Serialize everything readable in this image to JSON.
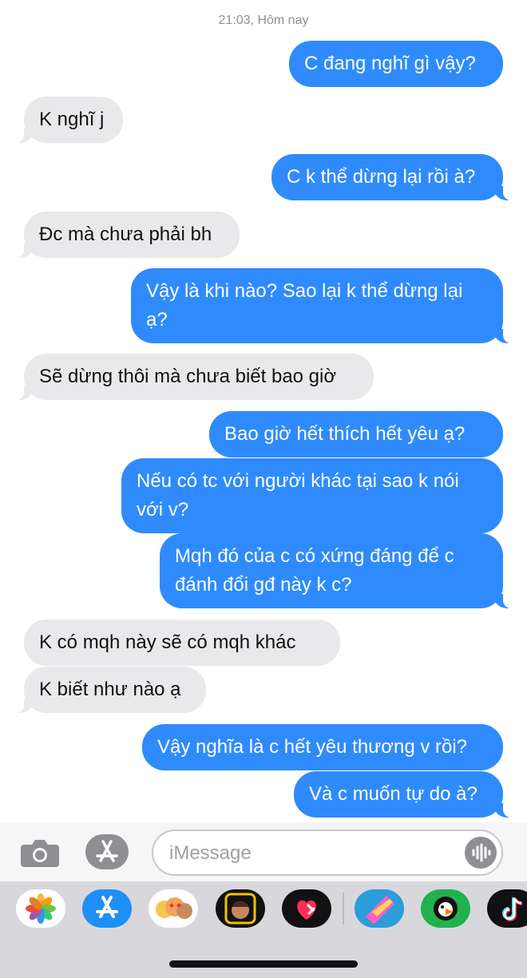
{
  "timestamp": "21:03, Hôm nay",
  "messages": [
    {
      "dir": "out",
      "text": "C đang nghĩ gì vậy?"
    },
    {
      "dir": "in",
      "text": "K nghĩ j"
    },
    {
      "dir": "out",
      "text": "C k thể dừng lại rồi à?"
    },
    {
      "dir": "in",
      "text": "Đc mà chưa phải bh"
    },
    {
      "dir": "out",
      "text": "Vậy là khi nào? Sao lại k thể dừng lại ạ?"
    },
    {
      "dir": "in",
      "text": "Sẽ dừng thôi mà chưa biết bao giờ"
    },
    {
      "dir": "out",
      "text": "Bao giờ hết thích hết yêu ạ?"
    },
    {
      "dir": "out",
      "text": "Nếu có tc với người khác tại sao k nói với v?"
    },
    {
      "dir": "out",
      "text": "Mqh đó của c có xứng đáng để c đánh đổi gđ này k c?"
    },
    {
      "dir": "in",
      "text": "K có mqh này sẽ có mqh khác"
    },
    {
      "dir": "in",
      "text": "K biết như nào ạ"
    },
    {
      "dir": "out",
      "text": "Vậy nghĩa là c hết yêu thương v rồi?"
    },
    {
      "dir": "out",
      "text": "Và c muốn tự do à?"
    }
  ],
  "input": {
    "placeholder": "iMessage",
    "value": ""
  },
  "icons": {
    "camera": "camera-icon",
    "app_store": "app-store-icon",
    "voice": "audio-waveform-icon"
  },
  "app_drawer": [
    "photos",
    "app-store",
    "memoji-stickers",
    "memoji",
    "digital-touch",
    "colorful-app",
    "puffin-app",
    "tiktok"
  ],
  "colors": {
    "outgoing": "#2f8bfb",
    "incoming": "#e9e9eb",
    "background": "#ffffff"
  }
}
